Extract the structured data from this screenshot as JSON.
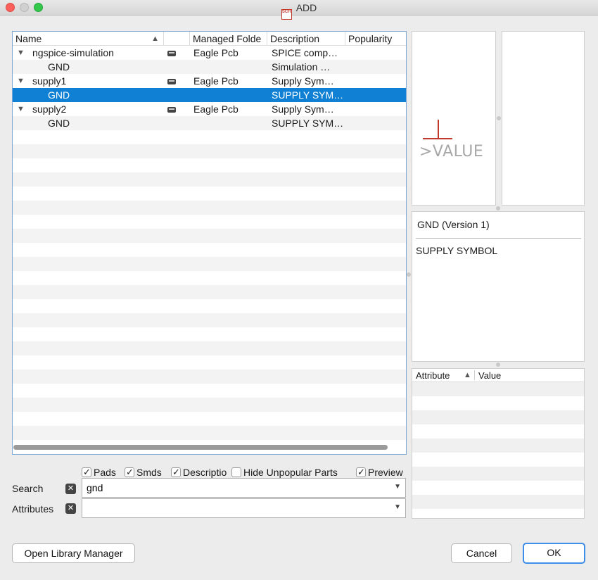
{
  "window": {
    "title": "ADD",
    "app_icon_text": "SCH"
  },
  "tree": {
    "columns": [
      "Name",
      "Managed Folde",
      "Description",
      "Popularity"
    ],
    "rows": [
      {
        "name": "ngspice-simulation",
        "level": 0,
        "expanded": true,
        "folder": "Eagle Pcb",
        "description": "SPICE comp…",
        "popularity": ""
      },
      {
        "name": "GND",
        "level": 1,
        "folder": "",
        "description": "Simulation …",
        "popularity": ""
      },
      {
        "name": "supply1",
        "level": 0,
        "expanded": true,
        "folder": "Eagle Pcb",
        "description": "Supply Sym…",
        "popularity": ""
      },
      {
        "name": "GND",
        "level": 1,
        "folder": "",
        "description": "SUPPLY SYM…",
        "popularity": "",
        "selected": true
      },
      {
        "name": "supply2",
        "level": 0,
        "expanded": true,
        "folder": "Eagle Pcb",
        "description": "Supply Sym…",
        "popularity": ""
      },
      {
        "name": "GND",
        "level": 1,
        "folder": "",
        "description": "SUPPLY SYM…",
        "popularity": ""
      }
    ]
  },
  "preview": {
    "symbol_text": ">VALUE"
  },
  "details": {
    "title": "GND (Version 1)",
    "description": "SUPPLY SYMBOL"
  },
  "attributes": {
    "col_attribute": "Attribute",
    "col_value": "Value"
  },
  "filters": {
    "pads": {
      "label": "Pads",
      "checked": true
    },
    "smds": {
      "label": "Smds",
      "checked": true
    },
    "description": {
      "label": "Descriptio",
      "checked": true
    },
    "hide_unpopular": {
      "label": "Hide Unpopular Parts",
      "checked": false
    },
    "preview": {
      "label": "Preview",
      "checked": true
    }
  },
  "search": {
    "label": "Search",
    "value": "gnd"
  },
  "attr_filter": {
    "label": "Attributes",
    "value": ""
  },
  "buttons": {
    "library_manager": "Open Library Manager",
    "cancel": "Cancel",
    "ok": "OK"
  },
  "colors": {
    "selection": "#1080d4",
    "symbol": "#c0392b",
    "ok_border": "#3d8ee8"
  }
}
